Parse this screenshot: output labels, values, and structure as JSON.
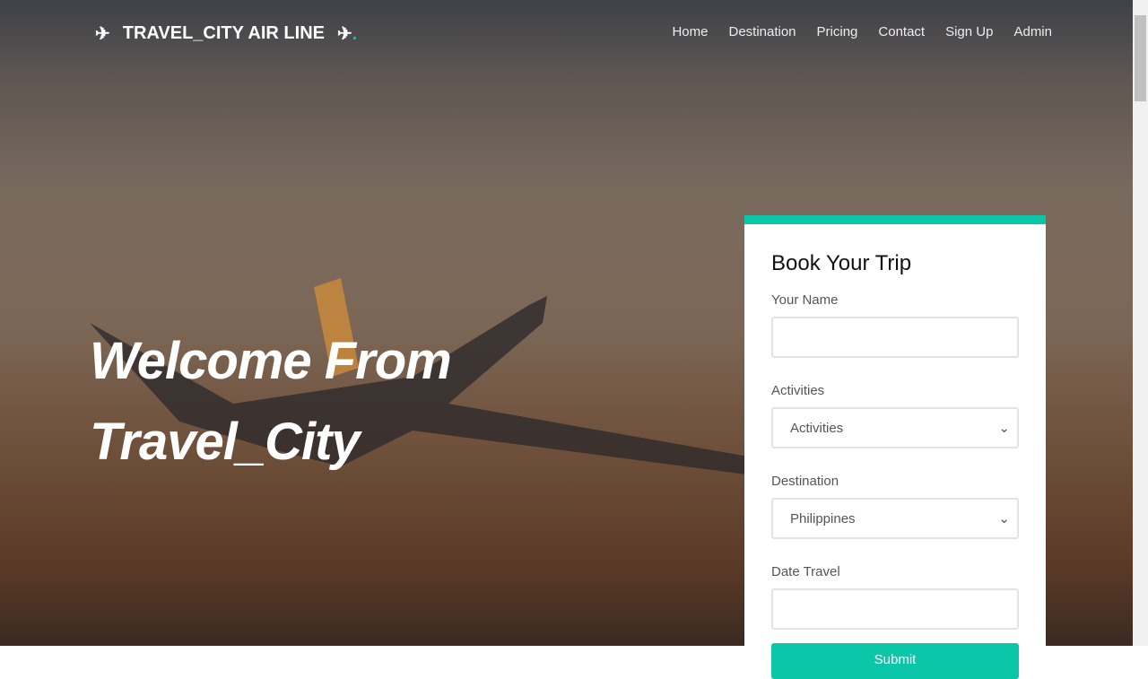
{
  "brand": {
    "title": "TRAVEL_CITY AIR LINE",
    "dot": "."
  },
  "nav": [
    "Home",
    "Destination",
    "Pricing",
    "Contact",
    "Sign Up",
    "Admin"
  ],
  "hero": {
    "line1": "Welcome From",
    "line2": "Travel_City"
  },
  "form": {
    "title": "Book Your Trip",
    "name_label": "Your Name",
    "name_value": "",
    "activities_label": "Activities",
    "activities_value": "Activities",
    "destination_label": "Destination",
    "destination_value": "Philippines",
    "date_label": "Date Travel",
    "date_value": "",
    "submit": "Submit"
  },
  "colors": {
    "accent": "#0bc6a9"
  }
}
